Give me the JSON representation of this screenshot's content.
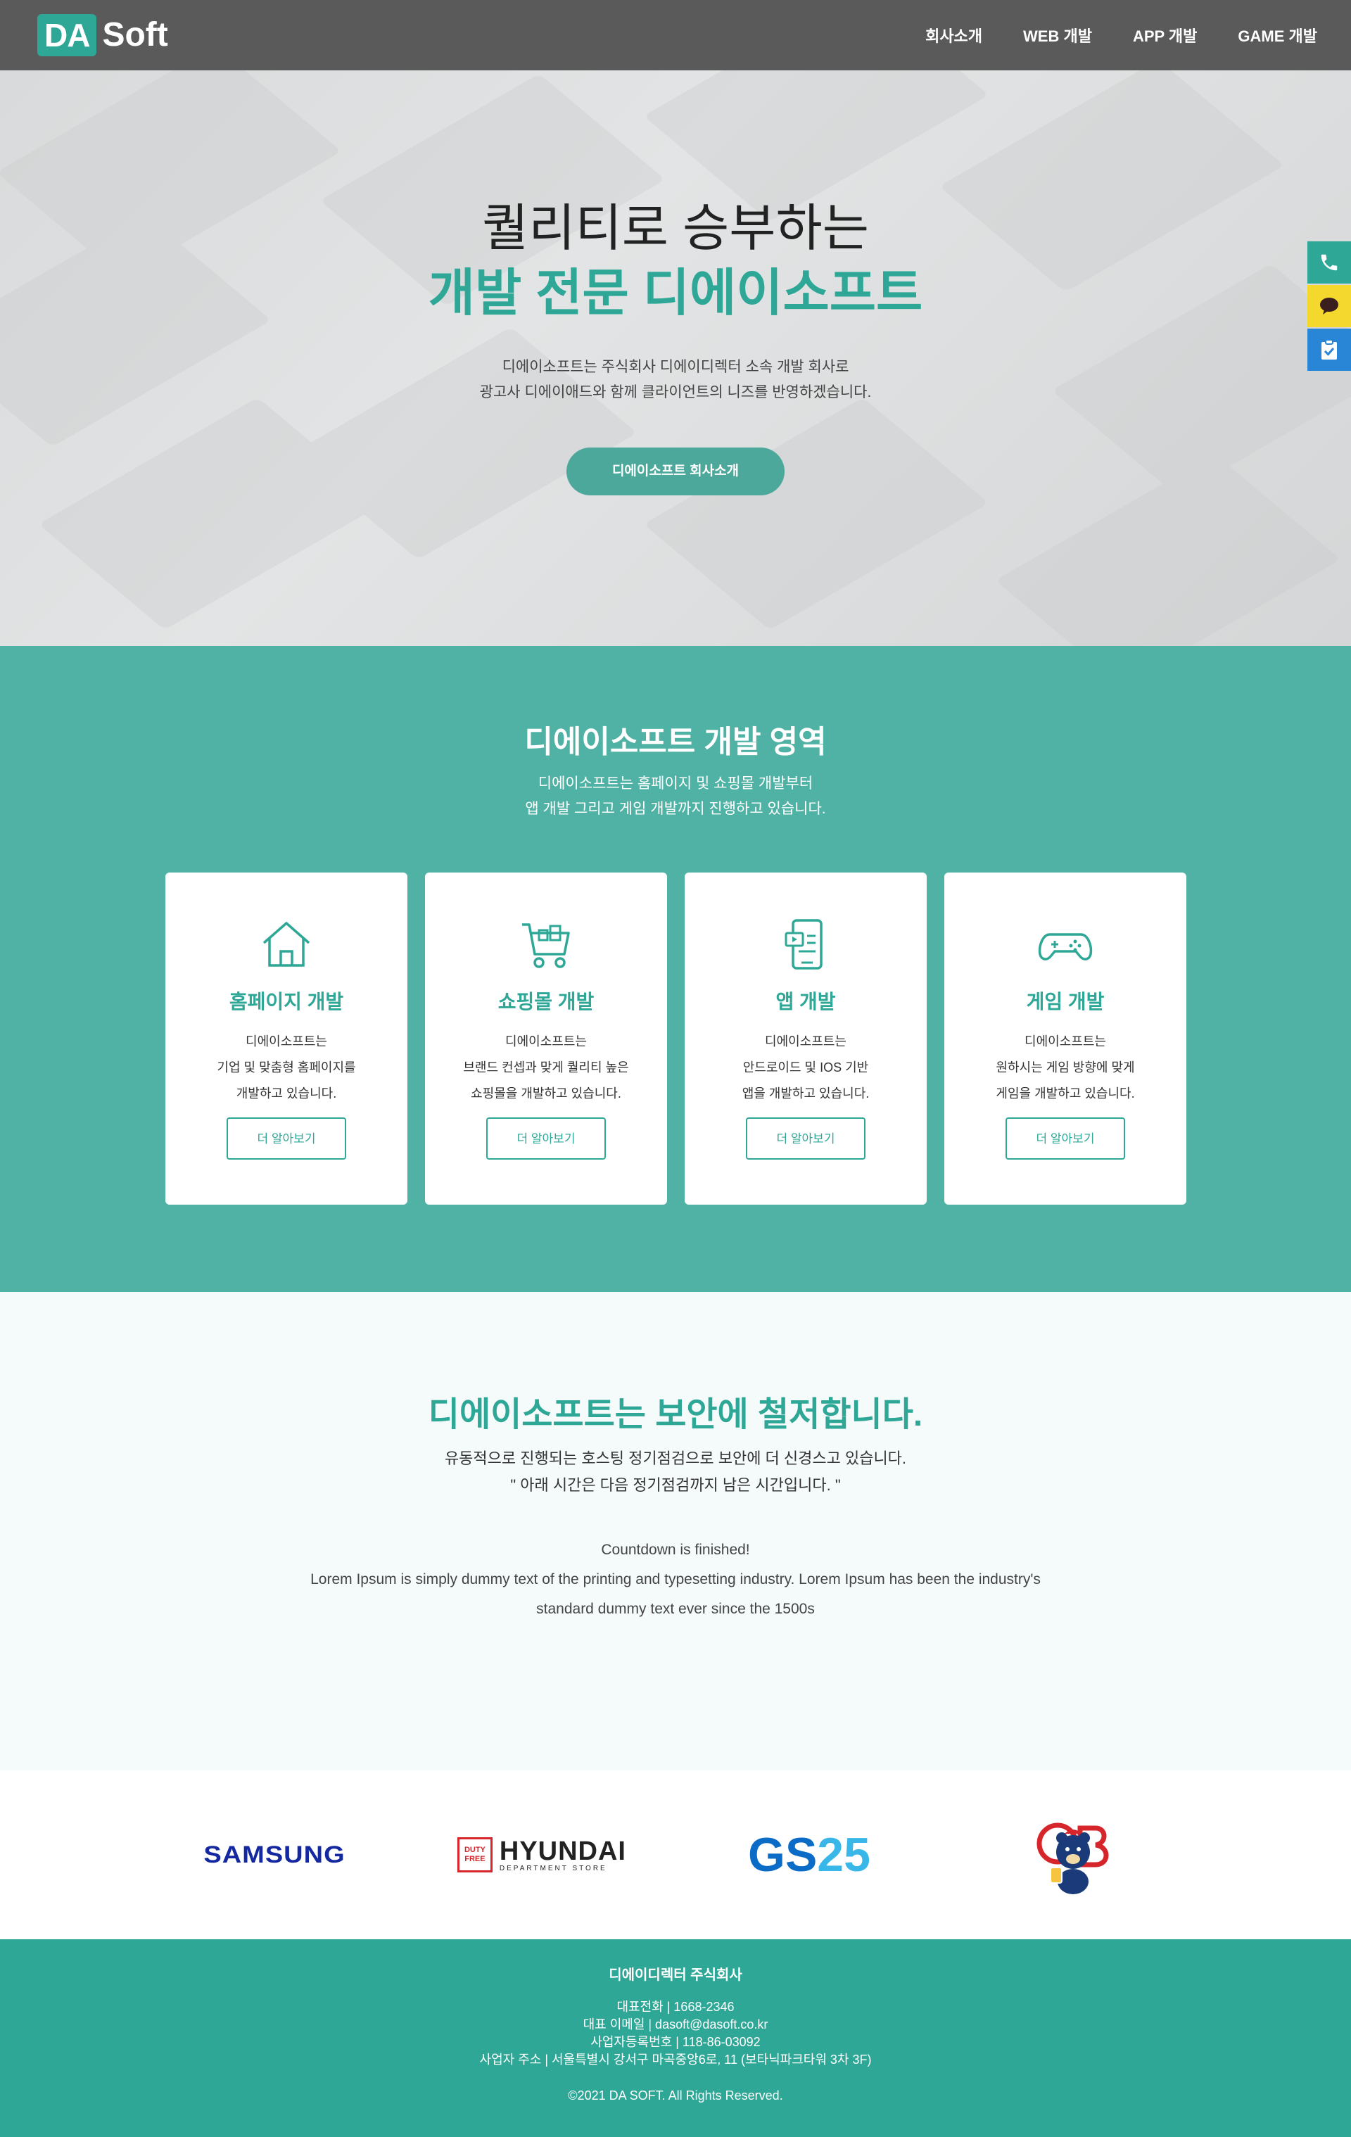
{
  "header": {
    "logo_box": "DA",
    "logo_text": "Soft",
    "nav": [
      "회사소개",
      "WEB 개발",
      "APP 개발",
      "GAME 개발"
    ]
  },
  "hero": {
    "line1": "퀄리티로 승부하는",
    "line2": "개발 전문 디에이소프트",
    "desc1": "디에이소프트는 주식회사 디에이디렉터 소속 개발 회사로",
    "desc2": "광고사 디에이애드와 함께 클라이언트의 니즈를 반영하겠습니다.",
    "button": "디에이소프트 회사소개"
  },
  "side_buttons": {
    "icons": [
      "phone-icon",
      "talk-icon",
      "clipboard-check-icon"
    ]
  },
  "service": {
    "title": "디에이소프트 개발 영역",
    "desc1": "디에이소프트는 홈페이지 및 쇼핑몰 개발부터",
    "desc2": "앱 개발 그리고 게임 개발까지 진행하고 있습니다.",
    "cards": [
      {
        "icon": "house-icon",
        "title": "홈페이지 개발",
        "line1": "디에이소프트는",
        "line2": "기업 및 맞춤형 홈페이지를",
        "line3": "개발하고 있습니다.",
        "button": "더 알아보기"
      },
      {
        "icon": "cart-icon",
        "title": "쇼핑몰 개발",
        "line1": "디에이소프트는",
        "line2": "브랜드 컨셉과 맞게 퀄리티 높은",
        "line3": "쇼핑몰을 개발하고 있습니다.",
        "button": "더 알아보기"
      },
      {
        "icon": "mobile-app-icon",
        "title": "앱 개발",
        "line1": "디에이소프트는",
        "line2": "안드로이드 및 IOS 기반",
        "line3": "앱을 개발하고 있습니다.",
        "button": "더 알아보기"
      },
      {
        "icon": "gamepad-icon",
        "title": "게임 개발",
        "line1": "디에이소프트는",
        "line2": "원하시는 게임 방향에 맞게",
        "line3": "게임을 개발하고 있습니다.",
        "button": "더 알아보기"
      }
    ]
  },
  "security": {
    "title": "디에이소프트는 보안에 철저합니다.",
    "desc1": "유동적으로 진행되는 호스팅 정기점검으로 보안에 더 신경스고 있습니다.",
    "desc2": "\" 아래 시간은 다음 정기점검까지 남은 시간입니다. \"",
    "countdown": "Countdown is finished!",
    "lorem1": "Lorem Ipsum is simply dummy text of the printing and typesetting industry. Lorem Ipsum has been the industry's",
    "lorem2": "standard dummy text ever since the 1500s"
  },
  "clients": {
    "samsung": "SAMSUNG",
    "hyundai_badge_1": "DUTY",
    "hyundai_badge_2": "FREE",
    "hyundai": "HYUNDAI",
    "hyundai_sub": "DEPARTMENT STORE",
    "gs_a": "GS",
    "gs_b": "25",
    "ob_o": "O",
    "ob_b": "B",
    "colors": {
      "samsung": "#1428a0",
      "hyundai": "#222222",
      "hyundai_badge": "#d6262b",
      "gs": "#0a6cc6",
      "gs_accent": "#39b7e8",
      "ob": "#d6262b"
    }
  },
  "footer": {
    "company": "디에이디렉터 주식회사",
    "phone": "대표전화 | 1668-2346",
    "email": "대표 이메일 | dasoft@dasoft.co.kr",
    "bizno": "사업자등록번호 | 118-86-03092",
    "address": "사업자 주소 | 서울특별시 강서구 마곡중앙6로, 11 (보타닉파크타워 3차 3F)",
    "copyright": "©2021 DA SOFT. All Rights Reserved."
  },
  "colors": {
    "accent": "#2ea797",
    "service_bg": "#4fb2a4",
    "header_bg": "#5a5a5a"
  }
}
